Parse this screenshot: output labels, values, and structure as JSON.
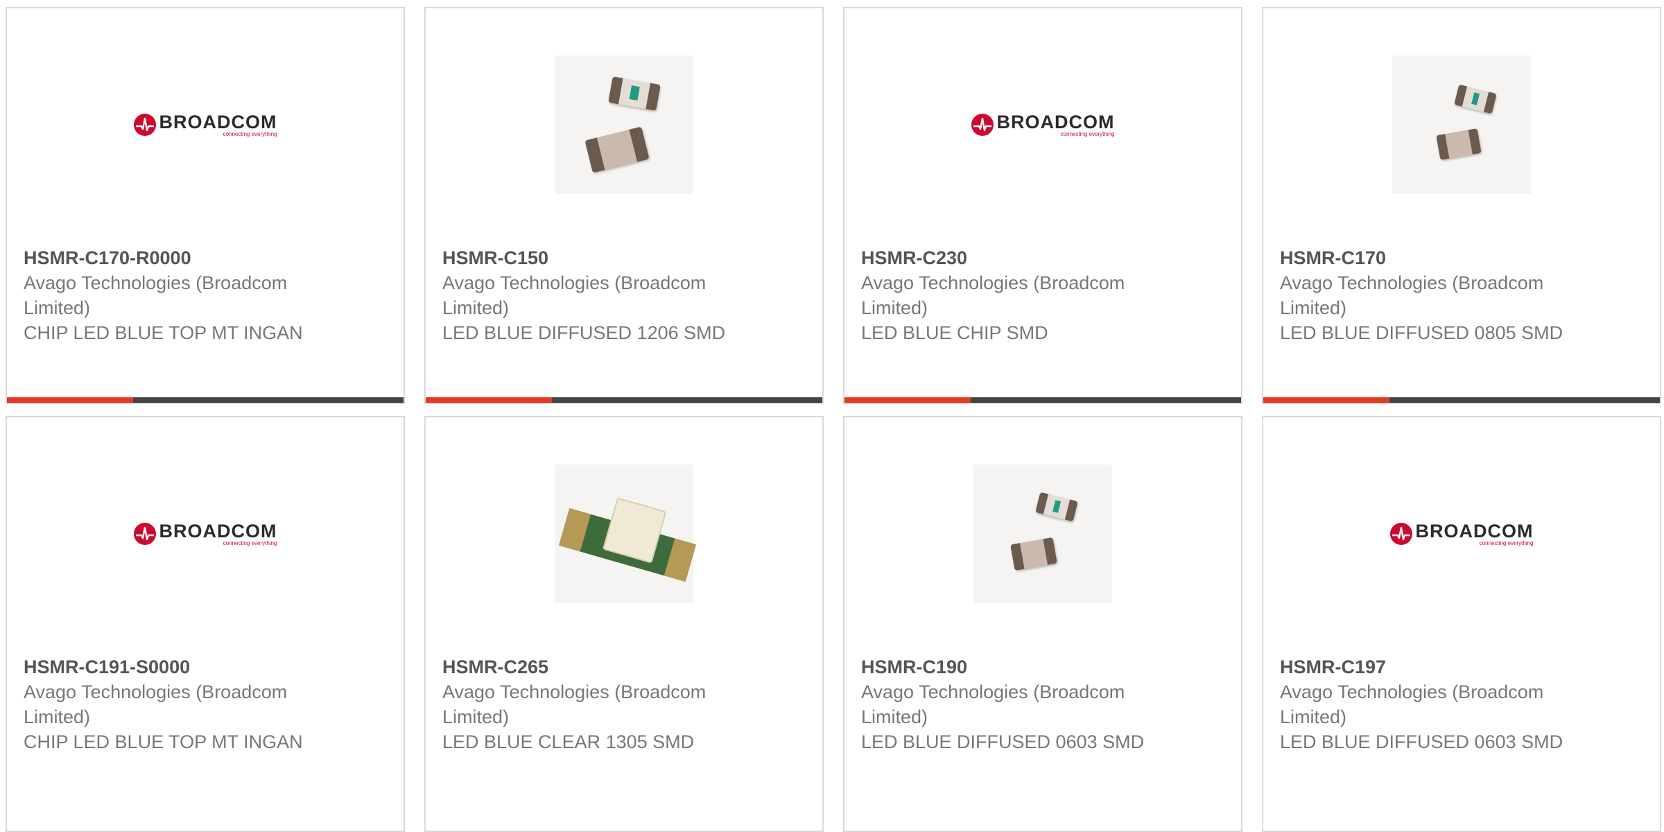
{
  "colors": {
    "accent": "#e8391f",
    "bar_dark": "#444444",
    "brand_red": "#cc092f"
  },
  "logo": {
    "brand": "BROADCOM",
    "tagline": "connecting everything"
  },
  "products": [
    {
      "part": "HSMR-C170-R0000",
      "manufacturer": "Avago Technologies (Broadcom Limited)",
      "description": "CHIP LED BLUE TOP MT INGAN",
      "image": "broadcom-logo"
    },
    {
      "part": "HSMR-C150",
      "manufacturer": "Avago Technologies (Broadcom Limited)",
      "description": "LED BLUE DIFFUSED 1206 SMD",
      "image": "led-chip-photo"
    },
    {
      "part": "HSMR-C230",
      "manufacturer": "Avago Technologies (Broadcom Limited)",
      "description": "LED BLUE CHIP SMD",
      "image": "broadcom-logo"
    },
    {
      "part": "HSMR-C170",
      "manufacturer": "Avago Technologies (Broadcom Limited)",
      "description": "LED BLUE DIFFUSED 0805 SMD",
      "image": "led-chip-photo"
    },
    {
      "part": "HSMR-C191-S0000",
      "manufacturer": "Avago Technologies (Broadcom Limited)",
      "description": "CHIP LED BLUE TOP MT INGAN",
      "image": "broadcom-logo"
    },
    {
      "part": "HSMR-C265",
      "manufacturer": "Avago Technologies (Broadcom Limited)",
      "description": "LED BLUE CLEAR 1305 SMD",
      "image": "led-lens-photo"
    },
    {
      "part": "HSMR-C190",
      "manufacturer": "Avago Technologies (Broadcom Limited)",
      "description": "LED BLUE DIFFUSED 0603 SMD",
      "image": "led-chip-photo"
    },
    {
      "part": "HSMR-C197",
      "manufacturer": "Avago Technologies (Broadcom Limited)",
      "description": "LED BLUE DIFFUSED 0603 SMD",
      "image": "broadcom-logo"
    }
  ]
}
